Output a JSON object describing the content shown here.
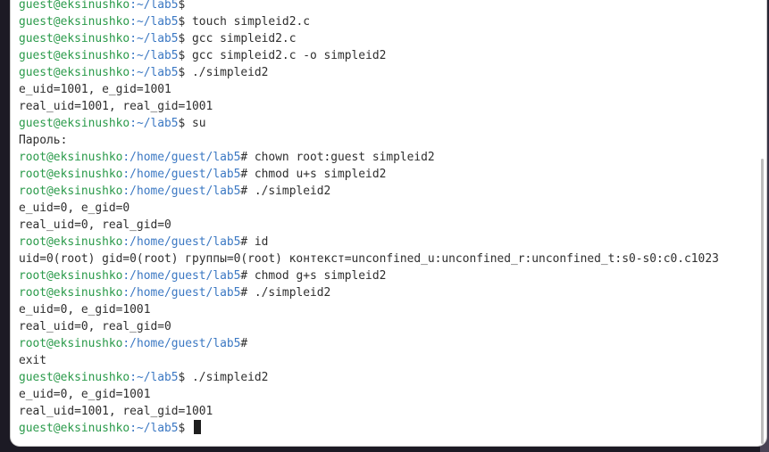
{
  "terminal": {
    "lines": [
      {
        "user": "guest@eksinushko",
        "path": ":~/lab5",
        "sym": "$",
        "cmd": ""
      },
      {
        "user": "guest@eksinushko",
        "path": ":~/lab5",
        "sym": "$",
        "cmd": " touch simpleid2.c"
      },
      {
        "user": "guest@eksinushko",
        "path": ":~/lab5",
        "sym": "$",
        "cmd": " gcc simpleid2.c"
      },
      {
        "user": "guest@eksinushko",
        "path": ":~/lab5",
        "sym": "$",
        "cmd": " gcc simpleid2.c -o simpleid2"
      },
      {
        "user": "guest@eksinushko",
        "path": ":~/lab5",
        "sym": "$",
        "cmd": " ./simpleid2"
      },
      {
        "text": "e_uid=1001, e_gid=1001"
      },
      {
        "text": "real_uid=1001, real_gid=1001"
      },
      {
        "user": "guest@eksinushko",
        "path": ":~/lab5",
        "sym": "$",
        "cmd": " su"
      },
      {
        "text": "Пароль:"
      },
      {
        "user": "root@eksinushko",
        "path": ":/home/guest/lab5",
        "sym": "#",
        "cmd": " chown root:guest simpleid2"
      },
      {
        "user": "root@eksinushko",
        "path": ":/home/guest/lab5",
        "sym": "#",
        "cmd": " chmod u+s simpleid2"
      },
      {
        "user": "root@eksinushko",
        "path": ":/home/guest/lab5",
        "sym": "#",
        "cmd": " ./simpleid2"
      },
      {
        "text": "e_uid=0, e_gid=0"
      },
      {
        "text": "real_uid=0, real_gid=0"
      },
      {
        "user": "root@eksinushko",
        "path": ":/home/guest/lab5",
        "sym": "#",
        "cmd": " id"
      },
      {
        "text": "uid=0(root) gid=0(root) группы=0(root) контекст=unconfined_u:unconfined_r:unconfined_t:s0-s0:c0.c1023"
      },
      {
        "user": "root@eksinushko",
        "path": ":/home/guest/lab5",
        "sym": "#",
        "cmd": " chmod g+s simpleid2"
      },
      {
        "user": "root@eksinushko",
        "path": ":/home/guest/lab5",
        "sym": "#",
        "cmd": " ./simpleid2"
      },
      {
        "text": "e_uid=0, e_gid=1001"
      },
      {
        "text": "real_uid=0, real_gid=0"
      },
      {
        "user": "root@eksinushko",
        "path": ":/home/guest/lab5",
        "sym": "#",
        "cmd": ""
      },
      {
        "text": "exit"
      },
      {
        "user": "guest@eksinushko",
        "path": ":~/lab5",
        "sym": "$",
        "cmd": " ./simpleid2"
      },
      {
        "text": "e_uid=0, e_gid=1001"
      },
      {
        "text": "real_uid=1001, real_gid=1001"
      },
      {
        "user": "guest@eksinushko",
        "path": ":~/lab5",
        "sym": "$",
        "cmd": " ",
        "cursor": true
      }
    ]
  },
  "colors": {
    "user": "#2a9a4a",
    "path": "#3b78c3",
    "text": "#2e2e2e",
    "background": "#ffffff"
  }
}
